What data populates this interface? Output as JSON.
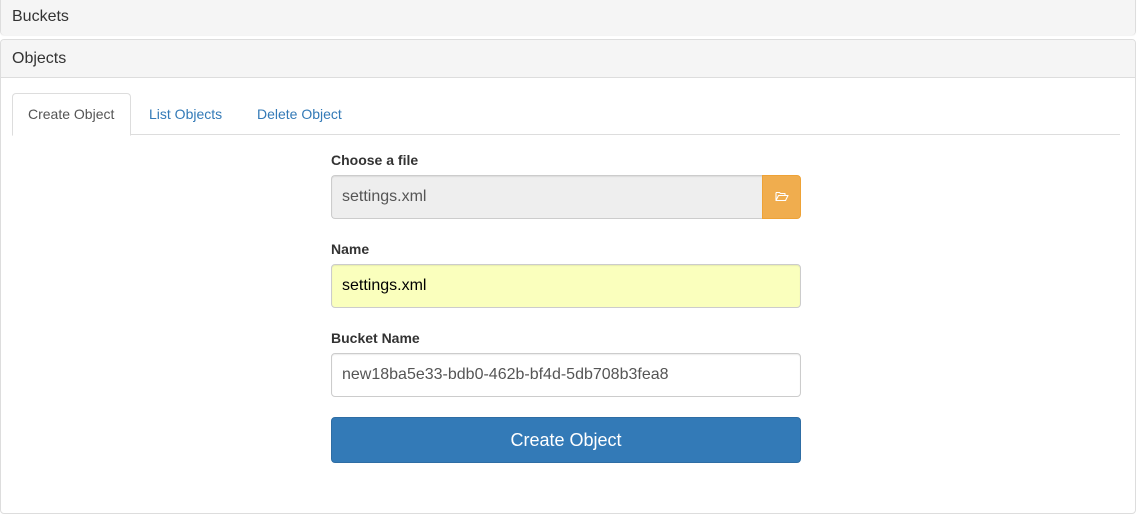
{
  "panels": {
    "buckets_title": "Buckets",
    "objects_title": "Objects"
  },
  "tabs": [
    {
      "label": "Create Object",
      "active": true
    },
    {
      "label": "List Objects",
      "active": false
    },
    {
      "label": "Delete Object",
      "active": false
    }
  ],
  "form": {
    "file_label": "Choose a file",
    "file_value": "settings.xml",
    "browse_icon": "folder-open-icon",
    "name_label": "Name",
    "name_value": "settings.xml",
    "bucket_label": "Bucket Name",
    "bucket_value": "new18ba5e33-bdb0-462b-bf4d-5db708b3fea8",
    "submit_label": "Create Object"
  },
  "colors": {
    "primary": "#337ab7",
    "warning": "#f0ad4e",
    "autofill": "#faffbd"
  }
}
